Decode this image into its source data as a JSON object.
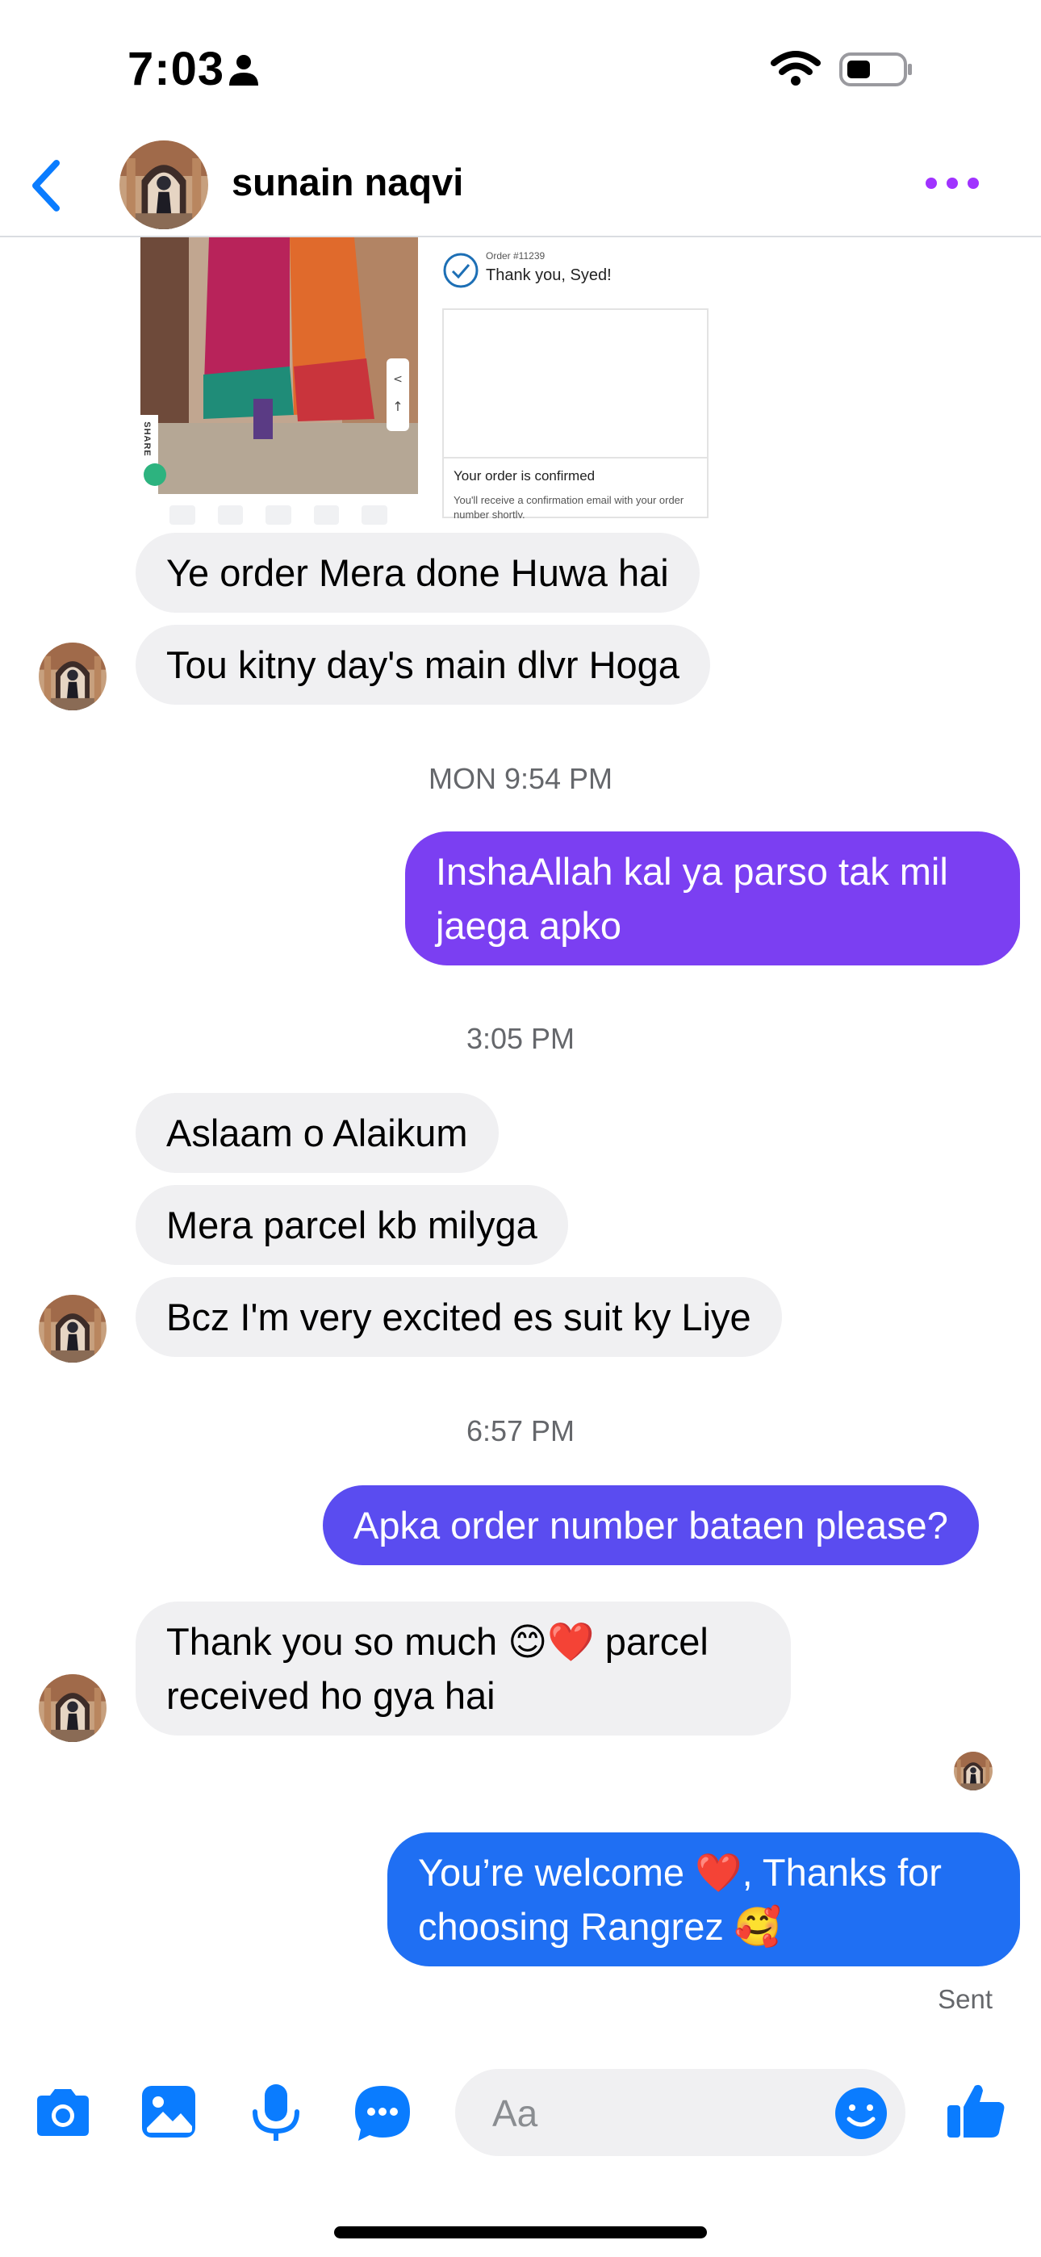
{
  "status_bar": {
    "time": "7:03"
  },
  "header": {
    "contact_name": "sunain naqvi"
  },
  "receipt": {
    "order_number": "Order #11239",
    "thank_you": "Thank you, Syed!",
    "confirmed_title": "Your order is confirmed",
    "confirmed_desc_line1": "You'll receive a confirmation email with your order",
    "confirmed_desc_line2": "number shortly."
  },
  "photo": {
    "share_label": "SHARE"
  },
  "messages": {
    "m1": "Ye order Mera done Huwa hai",
    "m2": "Tou kitny day's main dlvr Hoga",
    "ts1": "MON 9:54 PM",
    "m3_line1": "InshaAllah kal ya parso tak mil",
    "m3_line2": "jaega apko",
    "ts2": "3:05 PM",
    "m4": "Aslaam o Alaikum",
    "m5": "Mera parcel kb milyga",
    "m6": "Bcz I'm very excited es suit ky Liye",
    "ts3": "6:57 PM",
    "m7": "Apka order number bataen please?",
    "m8_line1_a": "Thank you so much ",
    "m8_line1_emoji": "😊❤️",
    "m8_line1_b": " parcel",
    "m8_line2": "received ho gya hai",
    "m9_line1_a": "You’re welcome ",
    "m9_line1_emoji": "❤️",
    "m9_line1_b": ", Thanks for",
    "m9_line2_a": "choosing Rangrez ",
    "m9_line2_emoji": "🥰",
    "status": "Sent"
  },
  "composer": {
    "placeholder": "Aa"
  },
  "colors": {
    "accent": "#0a7cff",
    "incoming_bubble": "#f0f0f2",
    "outgoing_purple": "#7b3ff2",
    "outgoing_indigo": "#5a4cf0",
    "outgoing_blue": "#1f6ff3",
    "more_dots": "#a033ff"
  },
  "icons": {
    "back": "chevron-left-icon",
    "more": "more-horizontal-icon",
    "camera": "camera-icon",
    "gallery": "image-icon",
    "mic": "microphone-icon",
    "chat_extras": "chat-bubble-dots-icon",
    "emoji": "smiley-icon",
    "like": "thumbs-up-icon"
  }
}
